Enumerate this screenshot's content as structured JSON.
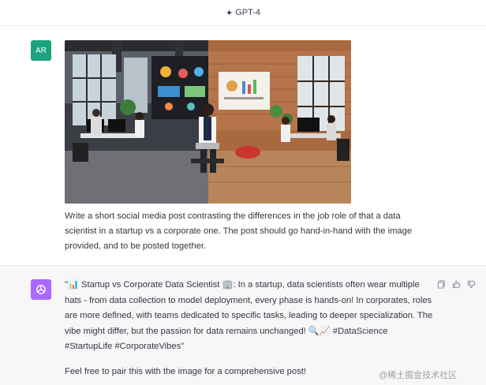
{
  "header": {
    "model_label": "GPT-4"
  },
  "user": {
    "avatar_initials": "AR",
    "message": "Write a short social media post contrasting the differences in the job role of that a data scientist in a startup vs a corporate one. The post should go hand-in-hand with the image provided, and to be posted together."
  },
  "assistant": {
    "message": "\"📊 Startup vs Corporate Data Scientist 🏢: In a startup, data scientists often wear multiple hats - from data collection to model deployment, every phase is hands-on! In corporates, roles are more defined, with teams dedicated to specific tasks, leading to deeper specialization. The vibe might differ, but the passion for data remains unchanged! 🔍📈 #DataScience #StartupLife #CorporateVibes\"",
    "followup": "Feel free to pair this with the image for a comprehensive post!"
  },
  "watermark": "@稀土掘金技术社区",
  "colors": {
    "user_avatar": "#1aa37f",
    "assistant_avatar": "#ab68ff",
    "assistant_bg": "#f7f7f8"
  }
}
